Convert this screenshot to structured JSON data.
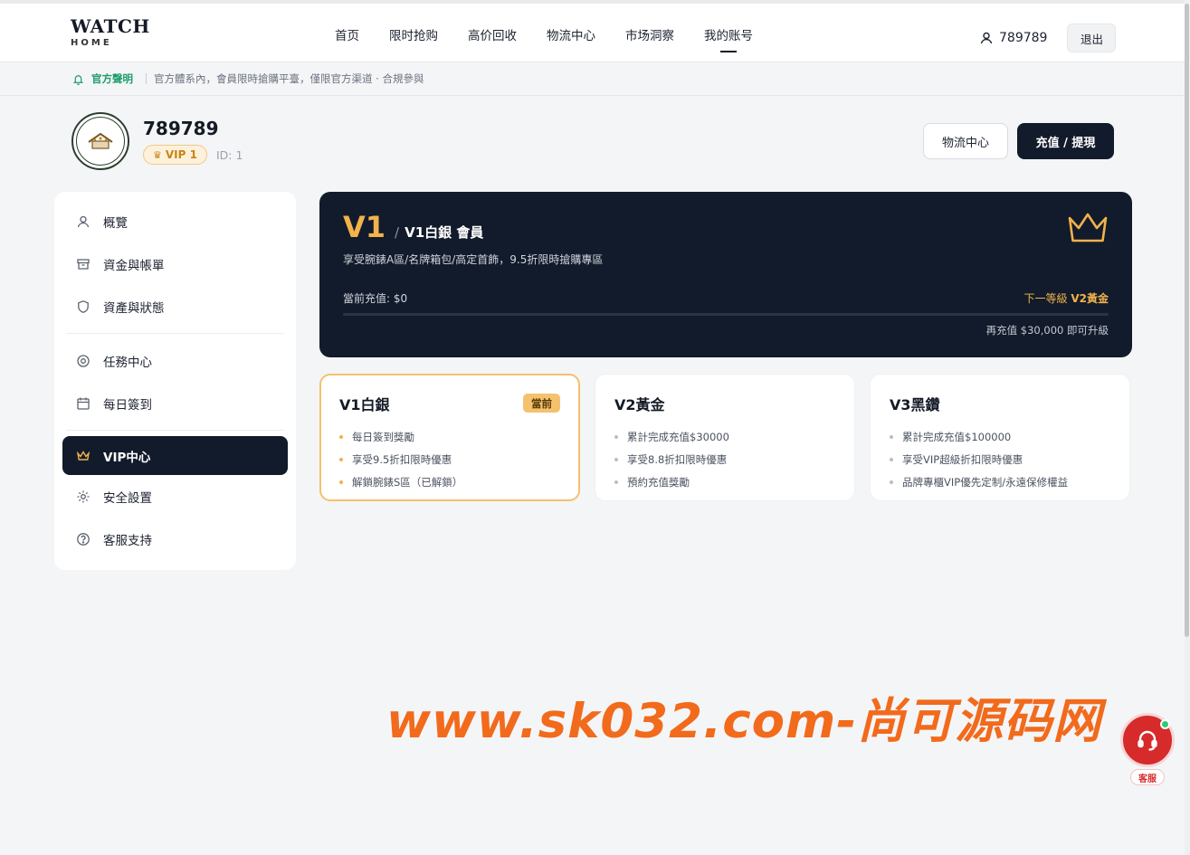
{
  "logo": {
    "main": "WATCH",
    "sub": "HOME"
  },
  "nav": {
    "items": [
      {
        "label": "首页",
        "active": false
      },
      {
        "label": "限时抢购",
        "active": false
      },
      {
        "label": "高价回收",
        "active": false
      },
      {
        "label": "物流中心",
        "active": false
      },
      {
        "label": "市场洞察",
        "active": false
      },
      {
        "label": "我的账号",
        "active": true
      }
    ]
  },
  "user": {
    "name": "789789",
    "logout_label": "退出"
  },
  "notice": {
    "label": "官方聲明",
    "text": "官方體系內，會員限時搶購平臺，僅限官方渠道 · 合規參與"
  },
  "profile": {
    "name": "789789",
    "vip_badge": "VIP 1",
    "id_label": "ID: 1"
  },
  "actions": {
    "logistics_label": "物流中心",
    "recharge_label": "充值 / 提現"
  },
  "sidebar": {
    "group1": [
      {
        "label": "概覽",
        "icon": "user-icon"
      },
      {
        "label": "資金與帳單",
        "icon": "box-icon"
      },
      {
        "label": "資產與狀態",
        "icon": "shield-icon"
      }
    ],
    "group2": [
      {
        "label": "任務中心",
        "icon": "target-icon"
      },
      {
        "label": "每日簽到",
        "icon": "calendar-icon"
      }
    ],
    "group3": [
      {
        "label": "VIP中心",
        "icon": "crown-icon",
        "active": true
      },
      {
        "label": "安全設置",
        "icon": "gear-icon"
      },
      {
        "label": "客服支持",
        "icon": "help-icon"
      }
    ]
  },
  "vip_card": {
    "level": "V1",
    "title": "V1白銀 會員",
    "description": "享受腕錶A區/名牌箱包/高定首飾，9.5折限時搶購專區",
    "current_recharge": "當前充值: $0",
    "next_prefix": "下一等級 ",
    "next_level": "V2黃金",
    "progress": 0,
    "remaining": "再充值 $30,000 即可升級"
  },
  "tiers": [
    {
      "name": "V1白銀",
      "current": true,
      "badge": "當前",
      "perks": [
        "每日簽到獎勵",
        "享受9.5折扣限時優惠",
        "解鎖腕錶S區（已解鎖）"
      ]
    },
    {
      "name": "V2黃金",
      "current": false,
      "badge": "",
      "perks": [
        "累計完成充值$30000",
        "享受8.8折扣限時優惠",
        "預約充值獎勵"
      ]
    },
    {
      "name": "V3黑鑽",
      "current": false,
      "badge": "",
      "perks": [
        "累計完成充值$100000",
        "享受VIP超級折扣限時優惠",
        "品牌專櫃VIP優先定制/永遠保修權益"
      ]
    }
  ],
  "watermark": "www.sk032.com-尚可源码网",
  "support_float": {
    "label": "客服"
  },
  "colors": {
    "accent": "#f2b24c",
    "dark": "#121b2b",
    "notice_green": "#1f9d6a",
    "support_red": "#d72a2a"
  }
}
